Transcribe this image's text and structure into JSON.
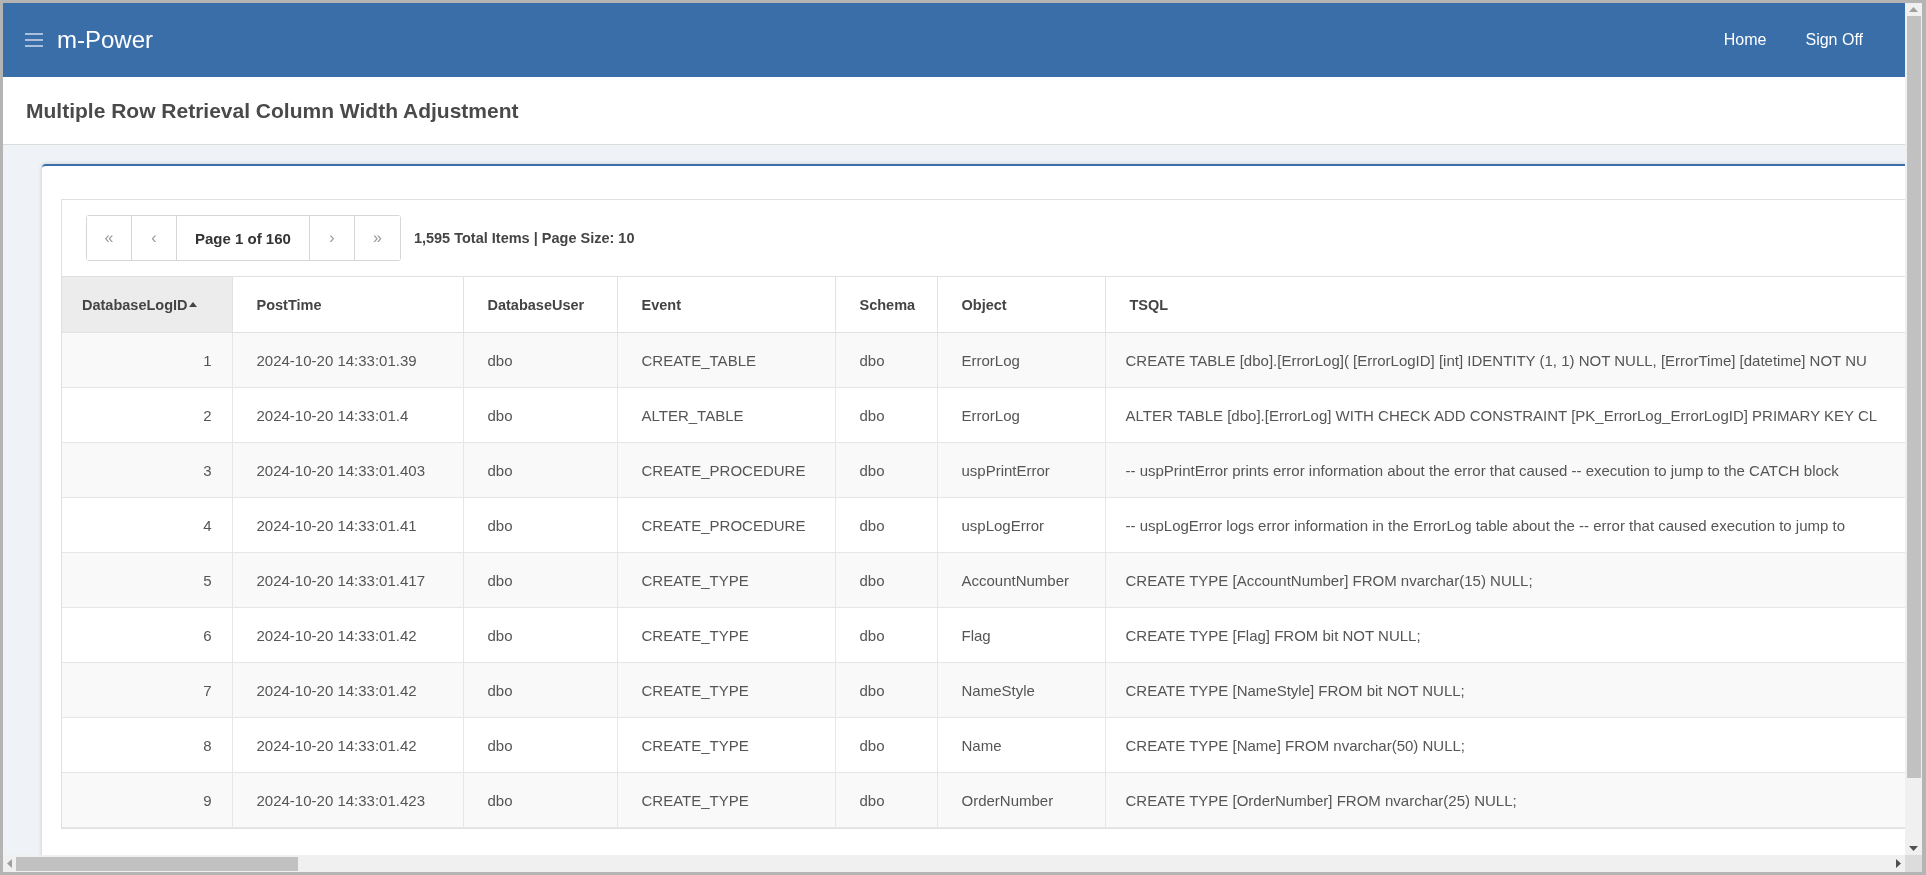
{
  "header": {
    "brand": "m-Power",
    "nav": [
      "Home",
      "Sign Off"
    ]
  },
  "page_title": "Multiple Row Retrieval Column Width Adjustment",
  "pager": {
    "first": "«",
    "prev": "‹",
    "page": "Page 1 of 160",
    "next": "›",
    "last": "»",
    "summary": "1,595 Total Items | Page Size: 10"
  },
  "table": {
    "columns": [
      {
        "label": "DatabaseLogID",
        "sorted": true
      },
      {
        "label": "PostTime",
        "sorted": false
      },
      {
        "label": "DatabaseUser",
        "sorted": false
      },
      {
        "label": "Event",
        "sorted": false
      },
      {
        "label": "Schema",
        "sorted": false
      },
      {
        "label": "Object",
        "sorted": false
      },
      {
        "label": "TSQL",
        "sorted": false
      }
    ],
    "rows": [
      [
        "1",
        "2024-10-20 14:33:01.39",
        "dbo",
        "CREATE_TABLE",
        "dbo",
        "ErrorLog",
        "CREATE TABLE [dbo].[ErrorLog]( [ErrorLogID] [int] IDENTITY (1, 1) NOT NULL, [ErrorTime] [datetime] NOT NU"
      ],
      [
        "2",
        "2024-10-20 14:33:01.4",
        "dbo",
        "ALTER_TABLE",
        "dbo",
        "ErrorLog",
        "ALTER TABLE [dbo].[ErrorLog] WITH CHECK ADD CONSTRAINT [PK_ErrorLog_ErrorLogID] PRIMARY KEY CL"
      ],
      [
        "3",
        "2024-10-20 14:33:01.403",
        "dbo",
        "CREATE_PROCEDURE",
        "dbo",
        "uspPrintError",
        "-- uspPrintError prints error information about the error that caused -- execution to jump to the CATCH block"
      ],
      [
        "4",
        "2024-10-20 14:33:01.41",
        "dbo",
        "CREATE_PROCEDURE",
        "dbo",
        "uspLogError",
        "-- uspLogError logs error information in the ErrorLog table about the -- error that caused execution to jump to"
      ],
      [
        "5",
        "2024-10-20 14:33:01.417",
        "dbo",
        "CREATE_TYPE",
        "dbo",
        "AccountNumber",
        "CREATE TYPE [AccountNumber] FROM nvarchar(15) NULL;"
      ],
      [
        "6",
        "2024-10-20 14:33:01.42",
        "dbo",
        "CREATE_TYPE",
        "dbo",
        "Flag",
        "CREATE TYPE [Flag] FROM bit NOT NULL;"
      ],
      [
        "7",
        "2024-10-20 14:33:01.42",
        "dbo",
        "CREATE_TYPE",
        "dbo",
        "NameStyle",
        "CREATE TYPE [NameStyle] FROM bit NOT NULL;"
      ],
      [
        "8",
        "2024-10-20 14:33:01.42",
        "dbo",
        "CREATE_TYPE",
        "dbo",
        "Name",
        "CREATE TYPE [Name] FROM nvarchar(50) NULL;"
      ],
      [
        "9",
        "2024-10-20 14:33:01.423",
        "dbo",
        "CREATE_TYPE",
        "dbo",
        "OrderNumber",
        "CREATE TYPE [OrderNumber] FROM nvarchar(25) NULL;"
      ]
    ]
  }
}
